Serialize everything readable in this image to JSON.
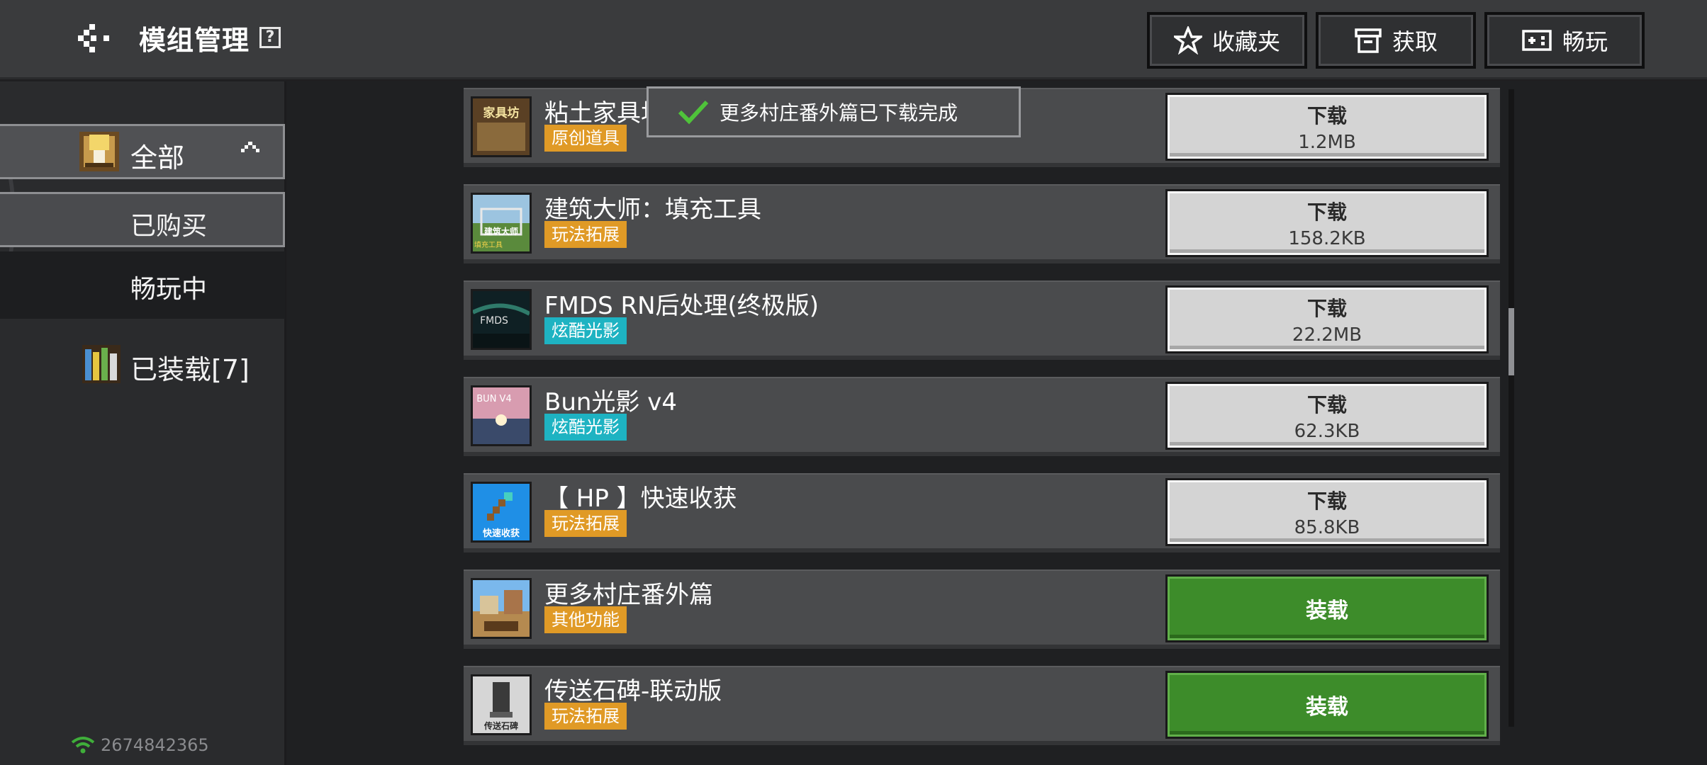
{
  "header": {
    "title": "模组管理",
    "help_icon": "?",
    "buttons": {
      "favorites": "收藏夹",
      "obtain": "获取",
      "play": "畅玩"
    }
  },
  "sidebar": {
    "all": "全部",
    "bought": "已购买",
    "playing": "畅玩中",
    "installed": "已装载[7]"
  },
  "status": {
    "id": "2674842365"
  },
  "toast": {
    "text": "更多村庄番外篇已下载完成"
  },
  "items": [
    {
      "title": "粘土家具坊",
      "tag": "原创道具",
      "tag_color": "orange",
      "action": "下载",
      "size": "1.2MB"
    },
    {
      "title": "建筑大师：填充工具",
      "tag": "玩法拓展",
      "tag_color": "orange",
      "action": "下载",
      "size": "158.2KB"
    },
    {
      "title": "FMDS RN后处理(终极版)",
      "tag": "炫酷光影",
      "tag_color": "teal",
      "action": "下载",
      "size": "22.2MB"
    },
    {
      "title": "Bun光影 v4",
      "tag": "炫酷光影",
      "tag_color": "teal",
      "action": "下载",
      "size": "62.3KB"
    },
    {
      "title": "【 HP 】快速收获",
      "tag": "玩法拓展",
      "tag_color": "orange",
      "action": "下载",
      "size": "85.8KB"
    },
    {
      "title": "更多村庄番外篇",
      "tag": "其他功能",
      "tag_color": "orange",
      "action": "装载"
    },
    {
      "title": "传送石碑-联动版",
      "tag": "玩法拓展",
      "tag_color": "orange",
      "action": "装载"
    }
  ],
  "thumb_text": {
    "item0": "家具坊",
    "item1": "建筑大师",
    "item1b": "填充工具",
    "item2": "FMDS",
    "item3": "BUN V4",
    "item4": "快速收获",
    "item6": "传送石碑"
  },
  "colors": {
    "tag_orange": "#e09a26",
    "tag_teal": "#1eb3c2",
    "load_green": "#3d8c2a",
    "download_gray": "#d4d4d4"
  }
}
